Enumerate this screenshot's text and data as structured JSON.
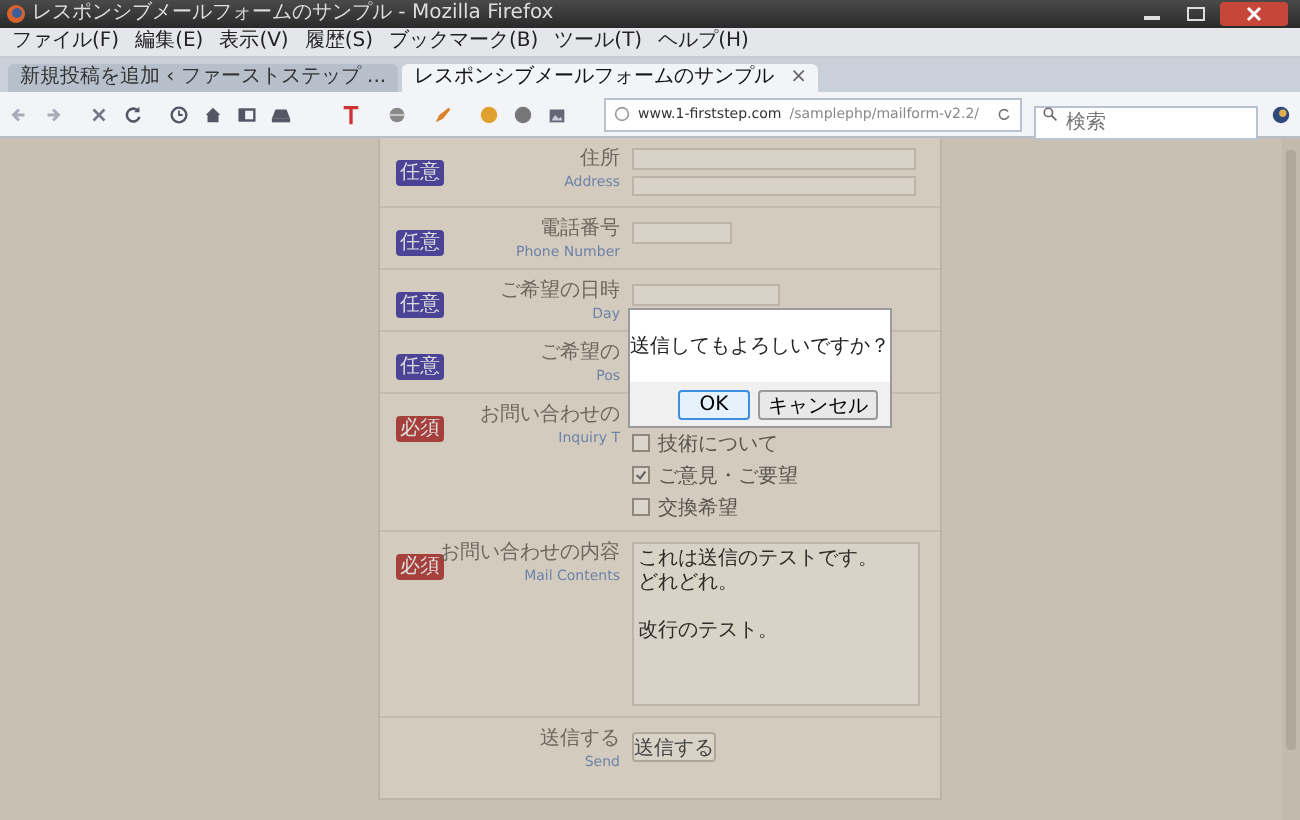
{
  "window": {
    "title": "レスポンシブメールフォームのサンプル - Mozilla Firefox"
  },
  "menu": [
    "ファイル(F)",
    "編集(E)",
    "表示(V)",
    "履歴(S)",
    "ブックマーク(B)",
    "ツール(T)",
    "ヘルプ(H)"
  ],
  "tabs": [
    {
      "label": "新規投稿を追加 ‹ ファーストステップ ...",
      "selected": false
    },
    {
      "label": "レスポンシブメールフォームのサンプル",
      "selected": true
    }
  ],
  "tab_close": "×",
  "address_bar": {
    "host": "www.1-firststep.com",
    "path": "/samplephp/mailform-v2.2/"
  },
  "search": {
    "placeholder": "検索"
  },
  "form": {
    "rows": [
      {
        "kind": "address",
        "badge": "任意",
        "required": false,
        "label": "住所",
        "sublabel": "Address"
      },
      {
        "kind": "short-input",
        "badge": "任意",
        "required": false,
        "label": "電話番号",
        "sublabel": "Phone Number"
      },
      {
        "kind": "medium-input",
        "badge": "任意",
        "required": false,
        "label": "ご希望の日時",
        "sublabel": "Day"
      },
      {
        "kind": "covered",
        "badge": "任意",
        "required": false,
        "label": "ご希望の",
        "sublabel": "Pos"
      },
      {
        "kind": "checkboxes",
        "badge": "必須",
        "required": true,
        "label": "お問い合わせの",
        "sublabel": "Inquiry T",
        "options": [
          {
            "label": "技術について",
            "checked": false
          },
          {
            "label": "ご意見・ご要望",
            "checked": true
          },
          {
            "label": "交換希望",
            "checked": false
          }
        ]
      },
      {
        "kind": "textarea",
        "badge": "必須",
        "required": true,
        "label": "お問い合わせの内容",
        "sublabel": "Mail Contents",
        "lines": [
          "これは送信のテストです。",
          "どれどれ。",
          "改行のテスト。"
        ]
      },
      {
        "kind": "submit",
        "label": "送信する",
        "sublabel": "Send",
        "button": "送信する"
      }
    ]
  },
  "dialog": {
    "message": "送信してもよろしいですか？",
    "buttons": [
      {
        "label": "OK",
        "selected": true
      },
      {
        "label": "キャンセル",
        "selected": false
      }
    ]
  }
}
